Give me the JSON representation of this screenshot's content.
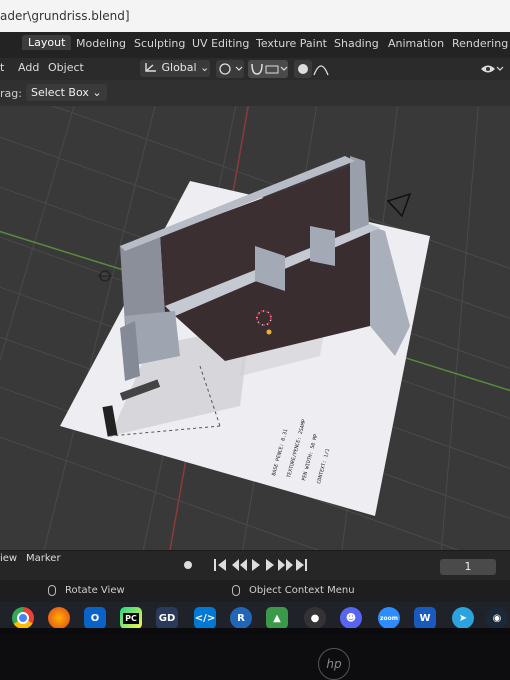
{
  "window": {
    "title": "ader\\grundriss.blend]"
  },
  "workspaces": {
    "tabs": [
      {
        "label": "Layout",
        "active": true
      },
      {
        "label": "Modeling"
      },
      {
        "label": "Sculpting"
      },
      {
        "label": "UV Editing"
      },
      {
        "label": "Texture Paint"
      },
      {
        "label": "Shading"
      },
      {
        "label": "Animation"
      },
      {
        "label": "Rendering"
      }
    ]
  },
  "header": {
    "menu_cut": "t",
    "menu_add": "Add",
    "menu_object": "Object",
    "orientation": "Global",
    "orientation_icon": "transform-orientation-icon"
  },
  "toolsettings": {
    "drag_label": "rag:",
    "select_mode": "Select Box"
  },
  "timeline": {
    "menu_view": "iew",
    "menu_marker": "Marker",
    "current_frame": "1"
  },
  "statusbar": {
    "rotate_view": "Rotate View",
    "context_menu": "Object Context Menu"
  },
  "taskbar": {
    "apps": [
      "chrome",
      "firefox",
      "outlook",
      "pycharm",
      "gdrive",
      "vscode",
      "r",
      "app",
      "github",
      "discord",
      "zoom",
      "word",
      "telegram",
      "steam"
    ]
  },
  "plan_text": {
    "line1": "BASE PENCE: 0.31",
    "line2": "TEXTURE/PENCE: 2SAMP",
    "line3": "PEN WIDTH: 50 MP",
    "line4": "CONTEXT: 1/1"
  },
  "bezel": {
    "brand": "hp"
  },
  "colors": {
    "accent": "#4b8fd7",
    "background": "#393939",
    "grid": "#4a4a4a",
    "x_axis": "#8a3b3b",
    "y_axis": "#5a8a3a"
  }
}
